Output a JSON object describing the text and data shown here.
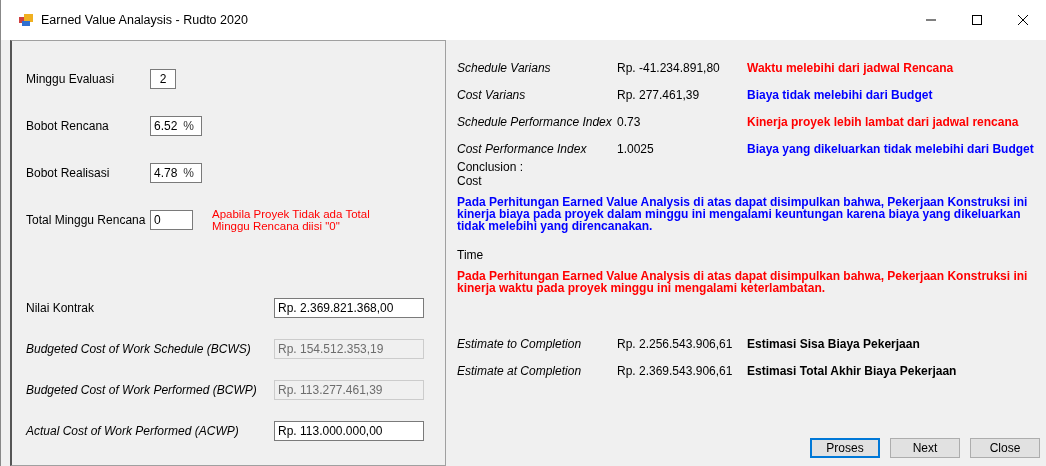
{
  "window": {
    "title": "Earned Value Analaysis - Rudto 2020"
  },
  "week_fields": [
    {
      "label": "Minggu Evaluasi",
      "value": "2",
      "kind": "center"
    },
    {
      "label": "Bobot Rencana",
      "value": "6.52",
      "unit": "%",
      "kind": "unit"
    },
    {
      "label": "Bobot Realisasi",
      "value": "4.78",
      "unit": "%",
      "kind": "unit"
    },
    {
      "label": "Total Minggu Rencana",
      "value": "0",
      "kind": "note",
      "note": "Apabila Proyek Tidak ada Total Minggu Rencana diisi \"0\""
    }
  ],
  "cost_fields": [
    {
      "label": "Nilai Kontrak",
      "value": "Rp. 2.369.821.368,00",
      "kind": "plain",
      "disabled": false
    },
    {
      "label": "Budgeted Cost of Work Schedule (BCWS)",
      "value": "Rp. 154.512.353,19",
      "kind": "term",
      "disabled": true
    },
    {
      "label": "Budgeted Cost of Work Performed (BCWP)",
      "value": "Rp. 113.277.461,39",
      "kind": "term",
      "disabled": true
    },
    {
      "label": "Actual Cost of Work Performed (ACWP)",
      "value": "Rp. 113.000.000,00",
      "kind": "term",
      "disabled": false
    }
  ],
  "results": [
    {
      "label": "Schedule Varians",
      "value": "Rp. -41.234.891,80",
      "remark": "Waktu melebihi dari jadwal Rencana",
      "color": "#ff0000"
    },
    {
      "label": "Cost Varians",
      "value": "Rp. 277.461,39",
      "remark": "Biaya tidak melebihi dari Budget",
      "color": "#0000ff"
    },
    {
      "label": "Schedule Performance Index",
      "value": "0.73",
      "remark": "Kinerja proyek lebih lambat dari jadwal rencana",
      "color": "#ff0000"
    },
    {
      "label": "Cost Performance Index",
      "value": "1.0025",
      "remark": "Biaya yang dikeluarkan tidak melebihi dari Budget",
      "color": "#0000ff"
    }
  ],
  "conclusion": {
    "heading": "Conclusion :",
    "sections": [
      {
        "title": "Cost",
        "text": "Pada Perhitungan Earned Value Analysis di atas dapat disimpulkan bahwa, Pekerjaan Konstruksi ini kinerja biaya pada proyek dalam minggu ini mengalami keuntungan karena biaya yang dikeluarkan tidak melebihi yang direncanakan.",
        "color": "#0000ff"
      },
      {
        "title": "Time",
        "text": "Pada Perhitungan Earned Value Analysis di atas dapat disimpulkan bahwa, Pekerjaan Konstruksi ini kinerja waktu pada proyek minggu ini mengalami keterlambatan.",
        "color": "#ff0000"
      }
    ]
  },
  "estimates": [
    {
      "label": "Estimate to Completion",
      "value": "Rp. 2.256.543.906,61",
      "remark": "Estimasi Sisa Biaya Pekerjaan"
    },
    {
      "label": "Estimate at Completion",
      "value": "Rp. 2.369.543.906,61",
      "remark": "Estimasi Total Akhir Biaya Pekerjaan"
    }
  ],
  "buttons": [
    {
      "label": "Proses",
      "focused": true
    },
    {
      "label": "Next",
      "focused": false
    },
    {
      "label": "Close",
      "focused": false
    }
  ]
}
